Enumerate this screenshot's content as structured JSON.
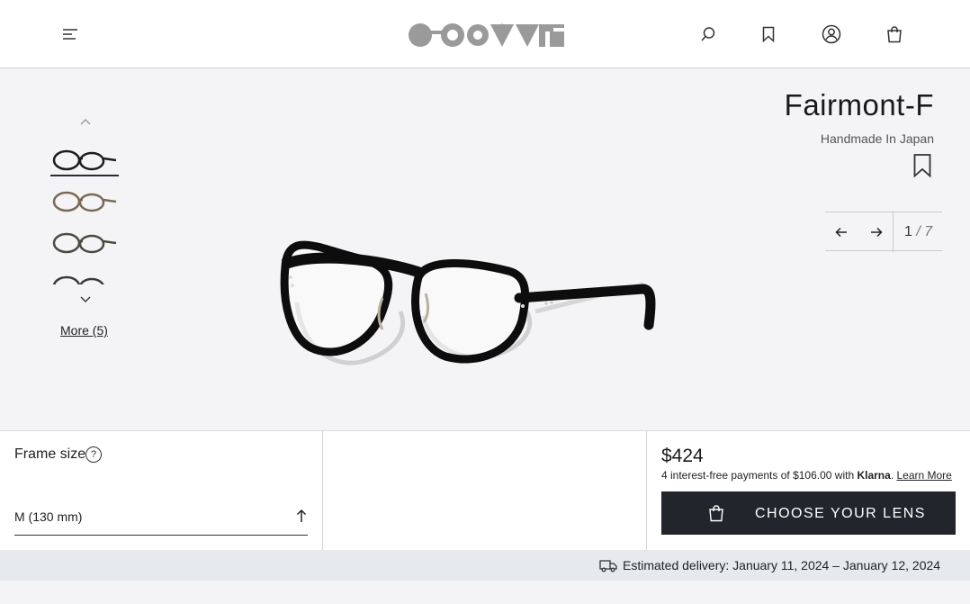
{
  "header": {
    "icons": {
      "menu": "menu-icon",
      "search": "search-icon",
      "wishlist": "bookmark-icon",
      "account": "user-icon",
      "cart": "bag-icon"
    }
  },
  "product": {
    "title": "Fairmont-F",
    "subtitle": "Handmade In Japan"
  },
  "gallery": {
    "more_label": "More (5)",
    "current": "1",
    "total_label": "/ 7"
  },
  "frame": {
    "label": "Frame size",
    "help": "?",
    "selected": "M (130 mm)"
  },
  "purchase": {
    "price": "$424",
    "installment_text": "4 interest-free payments of $106.00 with ",
    "provider": "Klarna",
    "learn_more": "Learn More",
    "cta_label": "CHOOSE YOUR LENS"
  },
  "delivery": {
    "text": "Estimated delivery: January 11, 2024 – January 12, 2024"
  },
  "colors": {
    "header_bg": "#ffffff",
    "hero_bg": "#f4f4f6",
    "cta_bg": "#22252c",
    "delivery_bg": "#e6eaee",
    "thumb_frames": [
      "#1c1c1c",
      "#7a6a55",
      "#4b4a40",
      "#3a3a3a"
    ]
  }
}
